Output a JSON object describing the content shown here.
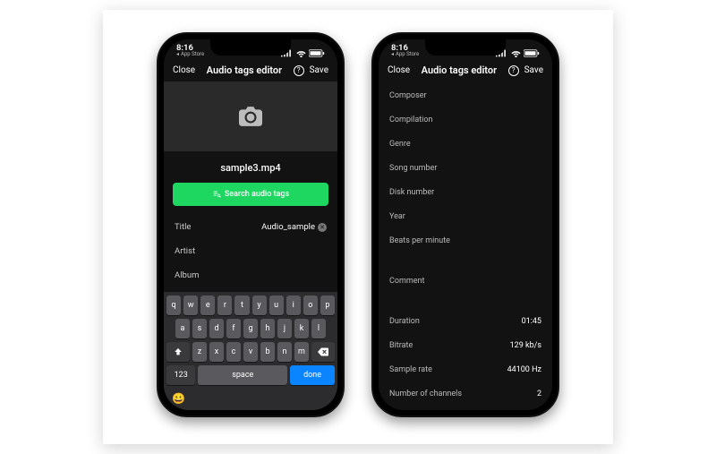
{
  "status": {
    "time": "8:16",
    "back_app": "App Store"
  },
  "nav": {
    "close": "Close",
    "title": "Audio tags editor",
    "save": "Save"
  },
  "left_phone": {
    "filename": "sample3.mp4",
    "search_btn": "Search audio tags",
    "fields": {
      "title_label": "Title",
      "title_value": "Audio_sample",
      "artist_label": "Artist",
      "album_label": "Album"
    },
    "keyboard": {
      "row1": [
        "q",
        "w",
        "e",
        "r",
        "t",
        "y",
        "u",
        "i",
        "o",
        "p"
      ],
      "row2": [
        "a",
        "s",
        "d",
        "f",
        "g",
        "h",
        "j",
        "k",
        "l"
      ],
      "row3": [
        "z",
        "x",
        "c",
        "v",
        "b",
        "n",
        "m"
      ],
      "num": "123",
      "space": "space",
      "done": "done"
    }
  },
  "right_phone": {
    "editable": {
      "composer": "Composer",
      "compilation": "Compilation",
      "genre": "Genre",
      "song_number": "Song number",
      "disk_number": "Disk number",
      "year": "Year",
      "bpm": "Beats per minute",
      "comment": "Comment"
    },
    "info": {
      "duration_label": "Duration",
      "duration_value": "01:45",
      "bitrate_label": "Bitrate",
      "bitrate_value": "129 kb/s",
      "samplerate_label": "Sample rate",
      "samplerate_value": "44100 Hz",
      "channels_label": "Number of channels",
      "channels_value": "2"
    }
  }
}
